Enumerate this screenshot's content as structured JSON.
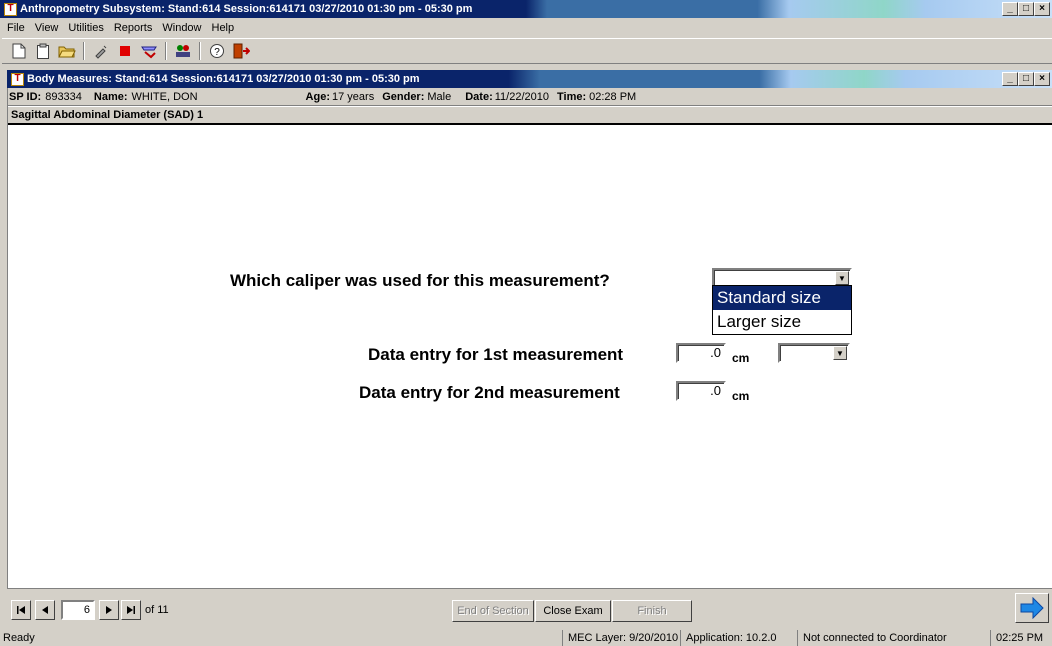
{
  "outer_window": {
    "title": "Anthropometry Subsystem: Stand:614 Session:614171 03/27/2010 01:30 pm - 05:30 pm",
    "buttons": [
      "_",
      "□",
      "×"
    ]
  },
  "menu": [
    "File",
    "View",
    "Utilities",
    "Reports",
    "Window",
    "Help"
  ],
  "toolbar": {
    "icons": [
      "new-document-icon",
      "clipboard-icon",
      "open-folder-icon",
      "syringe-icon",
      "stop-icon",
      "pencil-icon",
      "people-icon",
      "help-icon",
      "exit-door-icon"
    ]
  },
  "inner_window": {
    "title": "Body Measures: Stand:614 Session:614171 03/27/2010 01:30 pm - 05:30 pm",
    "buttons": [
      "_",
      "□",
      "×"
    ]
  },
  "participant": {
    "sp_id_label": "SP ID:",
    "sp_id": "893334",
    "name_label": "Name:",
    "name": "WHITE, DON",
    "age_label": "Age:",
    "age": "17 years",
    "gender_label": "Gender:",
    "gender": "Male",
    "date_label": "Date:",
    "date": "11/22/2010",
    "time_label": "Time:",
    "time": "02:28 PM"
  },
  "section": {
    "title": "Sagittal Abdominal Diameter (SAD) 1"
  },
  "form": {
    "caliper_question": "Which caliper was used for this measurement?",
    "caliper_options": [
      "Standard size",
      "Larger size"
    ],
    "caliper_highlighted": "Standard size",
    "measure1_label": "Data entry for 1st measurement",
    "measure1_value": ".0",
    "measure1_unit": "cm",
    "measure2_label": "Data entry for 2nd measurement",
    "measure2_value": ".0",
    "measure2_unit": "cm"
  },
  "navigation": {
    "current_page": "6",
    "of_total": "of 11",
    "end_of_section": "End of Section",
    "close_exam": "Close Exam",
    "finish": "Finish"
  },
  "status": {
    "ready": "Ready",
    "mec_layer": "MEC Layer: 9/20/2010",
    "application": "Application: 10.2.0",
    "coordinator": "Not connected to Coordinator",
    "clock": "02:25 PM"
  },
  "colors": {
    "titlebar_active": "#0a246a",
    "selection": "#0a246a",
    "window_face": "#d4d0c8",
    "next_arrow": "#1e88e5"
  }
}
